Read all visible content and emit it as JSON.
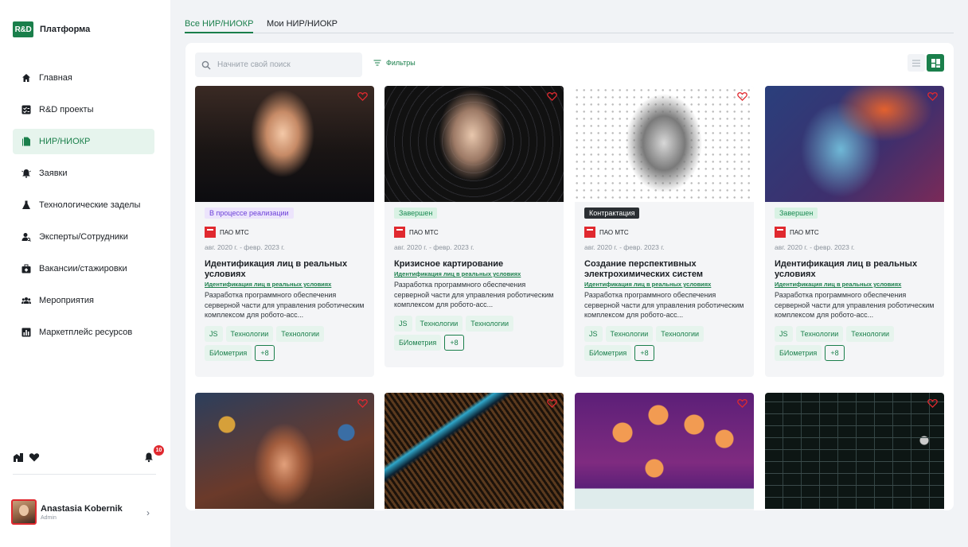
{
  "app": {
    "logo_text": "R&D",
    "name": "Платформа"
  },
  "sidebar": {
    "items": [
      {
        "label": "Главная",
        "icon": "home-icon",
        "active": false
      },
      {
        "label": "R&D проекты",
        "icon": "projects-icon",
        "active": false
      },
      {
        "label": "НИР/НИОКР",
        "icon": "document-icon",
        "active": true
      },
      {
        "label": "Заявки",
        "icon": "bell-ring-icon",
        "active": false
      },
      {
        "label": "Технологические заделы",
        "icon": "flask-icon",
        "active": false
      },
      {
        "label": "Эксперты/Сотрудники",
        "icon": "user-search-icon",
        "active": false
      },
      {
        "label": "Вакансии/стажировки",
        "icon": "briefcase-icon",
        "active": false
      },
      {
        "label": "Мероприятия",
        "icon": "people-icon",
        "active": false
      },
      {
        "label": "Маркетплейс ресурсов",
        "icon": "chart-icon",
        "active": false
      }
    ],
    "notifications_count": "10",
    "user": {
      "name": "Anastasia Kobernik",
      "role": "Admin"
    }
  },
  "tabs": [
    {
      "label": "Все НИР/НИОКР",
      "active": true
    },
    {
      "label": "Мои НИР/НИОКР",
      "active": false
    }
  ],
  "toolbar": {
    "search_placeholder": "Начните свой поиск",
    "filters_label": "Фильтры",
    "view_mode": "grid"
  },
  "cards": [
    {
      "status": "В процессе реализации",
      "status_type": "progress",
      "org": "ПАО МТС",
      "dates": "авг. 2020 г. - февр. 2023 г.",
      "title": "Идентификация лиц в реальных условиях",
      "subtitle": "Идентификация лиц в реальных условиях",
      "description": "Разработка программного обеспечения серверной части для управления роботическим комплексом для робото-асс...",
      "tags": [
        "JS",
        "Технологии",
        "Технологии",
        "БИометрия"
      ],
      "more": "+8"
    },
    {
      "status": "Завершен",
      "status_type": "done",
      "org": "ПАО МТС",
      "dates": "авг. 2020 г. - февр. 2023 г.",
      "title": "Кризисное картирование",
      "subtitle": "Идентификация лиц в реальных условиях",
      "description": "Разработка программного обеспечения серверной части для управления роботическим комплексом для робото-асс...",
      "tags": [
        "JS",
        "Технологии",
        "Технологии",
        "БИометрия"
      ],
      "more": "+8"
    },
    {
      "status": "Контрактация",
      "status_type": "contract",
      "org": "ПАО МТС",
      "dates": "авг. 2020 г. - февр. 2023 г.",
      "title": "Создание перспективных электрохимических систем хранени...",
      "subtitle": "Идентификация лиц в реальных условиях",
      "description": "Разработка программного обеспечения серверной части для управления роботическим комплексом для робото-асс...",
      "tags": [
        "JS",
        "Технологии",
        "Технологии",
        "БИометрия"
      ],
      "more": "+8"
    },
    {
      "status": "Завершен",
      "status_type": "done",
      "org": "ПАО МТС",
      "dates": "авг. 2020 г. - февр. 2023 г.",
      "title": "Идентификация лиц в реальных условиях",
      "subtitle": "Идентификация лиц в реальных условиях",
      "description": "Разработка программного обеспечения серверной части для управления роботическим комплексом для робото-асс...",
      "tags": [
        "JS",
        "Технологии",
        "Технологии",
        "БИометрия"
      ],
      "more": "+8"
    }
  ],
  "colors": {
    "accent": "#1a7f4b",
    "danger": "#e0292f",
    "progress": "#6b3fd8"
  }
}
